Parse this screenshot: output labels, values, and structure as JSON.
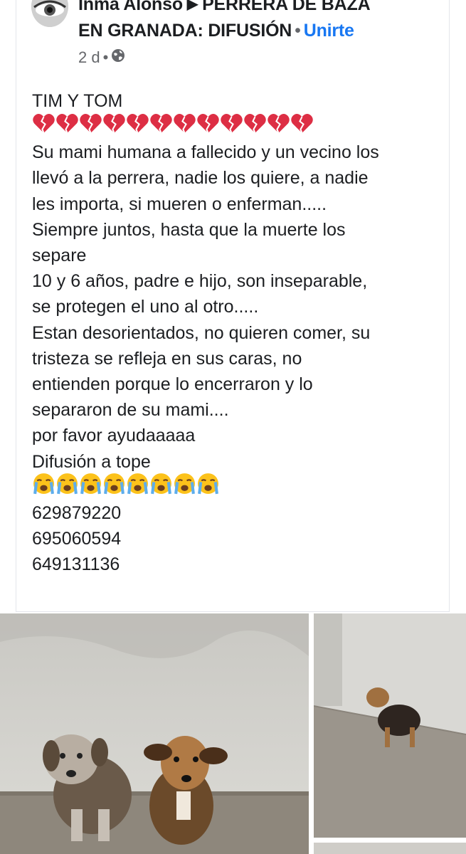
{
  "header": {
    "author": "Inma Alonso",
    "group_line1": "PERRERA DE BAZA",
    "group_line2": "EN GRANADA: DIFUSIÓN",
    "join_label": "Unirte",
    "timestamp": "2 d",
    "privacy_icon": "globe-icon"
  },
  "post": {
    "title": "TIM Y TOM",
    "heart_emoji": "broken-heart",
    "heart_count": 12,
    "lines": [
      "Su mami humana a fallecido y un vecino los",
      "llevó a la perrera, nadie los quiere, a nadie",
      "les importa, si mueren o enferman.....",
      "Siempre juntos, hasta que la muerte los",
      "separe",
      "10 y 6 años, padre e hijo, son inseparable,",
      "se protegen el uno al otro.....",
      "Estan desorientados, no quieren comer, su",
      "tristeza se refleja en sus caras, no",
      "entienden porque lo encerraron y lo",
      "separaron de su mami....",
      "por favor ayudaaaaa",
      "Difusión a tope"
    ],
    "crying_emoji": "loudly-crying-face",
    "crying_count": 8,
    "phones": [
      "629879220",
      "695060594",
      "649131136"
    ]
  },
  "colors": {
    "text": "#1c1e21",
    "meta": "#65676b",
    "link": "#1877f2",
    "border": "#e4e6eb"
  }
}
